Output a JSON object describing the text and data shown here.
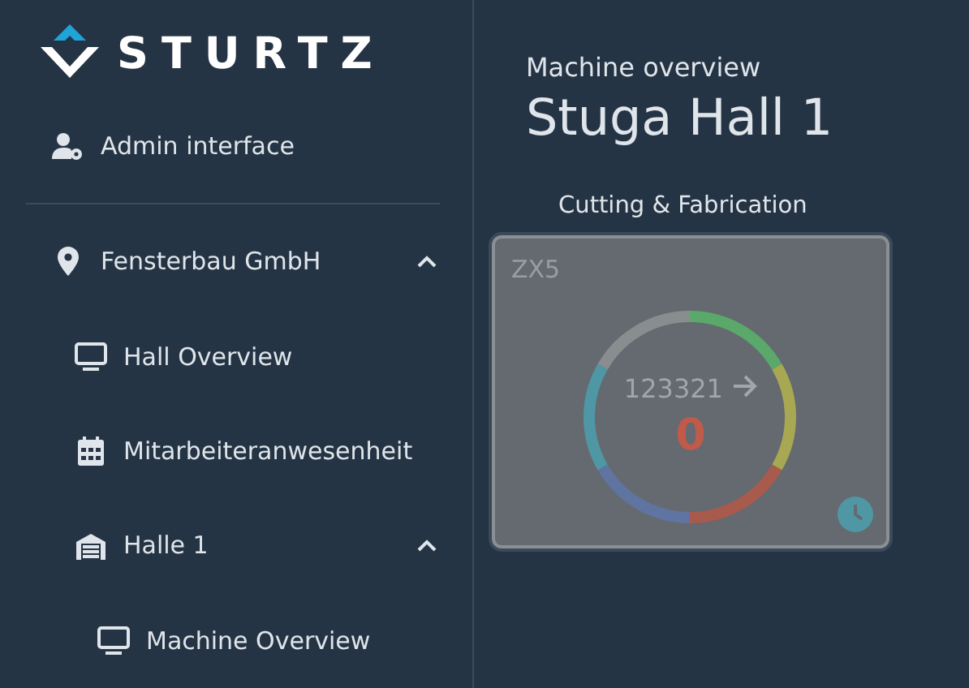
{
  "logo": {
    "text": "STURTZ"
  },
  "sidebar": {
    "items": [
      {
        "kind": "admin",
        "label": "Admin interface"
      },
      {
        "kind": "location",
        "label": "Fensterbau GmbH",
        "expanded": true,
        "children": [
          {
            "kind": "monitor",
            "label": "Hall Overview"
          },
          {
            "kind": "calendar",
            "label": "Mitarbeiteranwesenheit"
          },
          {
            "kind": "hall",
            "label": "Halle 1",
            "expanded": true,
            "children": [
              {
                "kind": "monitor",
                "label": "Machine Overview"
              }
            ]
          }
        ]
      }
    ]
  },
  "header": {
    "subtitle": "Machine overview",
    "title": "Stuga Hall 1"
  },
  "groups": [
    {
      "title": "Cutting & Fabrication",
      "machines": [
        {
          "name": "ZX5",
          "count": "123321",
          "value": "0",
          "segments": [
            {
              "color": "#5aa86a"
            },
            {
              "color": "#a8a853"
            },
            {
              "color": "#a85a4d"
            },
            {
              "color": "#5f74a0"
            },
            {
              "color": "#4f97a4"
            },
            {
              "color": "#8a8d90"
            }
          ]
        }
      ]
    }
  ]
}
